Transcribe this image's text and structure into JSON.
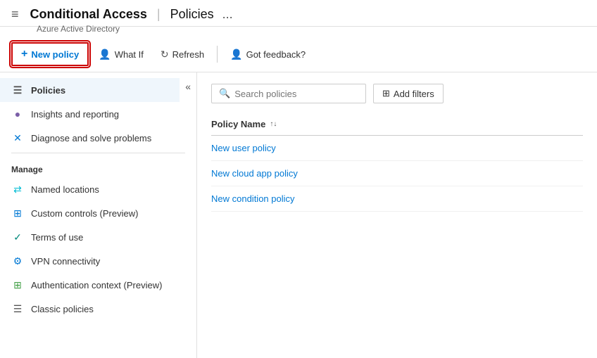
{
  "header": {
    "app_name": "Conditional Access",
    "page_title": "Policies",
    "subtitle": "Azure Active Directory",
    "ellipsis_label": "..."
  },
  "toolbar": {
    "new_policy_label": "New policy",
    "what_if_label": "What If",
    "refresh_label": "Refresh",
    "feedback_label": "Got feedback?"
  },
  "sidebar": {
    "collapse_label": "«",
    "items": [
      {
        "id": "policies",
        "label": "Policies",
        "icon": "☰",
        "active": true
      },
      {
        "id": "insights",
        "label": "Insights and reporting",
        "icon": "💡"
      },
      {
        "id": "diagnose",
        "label": "Diagnose and solve problems",
        "icon": "✕"
      }
    ],
    "manage_section": "Manage",
    "manage_items": [
      {
        "id": "named-locations",
        "label": "Named locations",
        "icon": "◇"
      },
      {
        "id": "custom-controls",
        "label": "Custom controls (Preview)",
        "icon": "⊞"
      },
      {
        "id": "terms-of-use",
        "label": "Terms of use",
        "icon": "✓"
      },
      {
        "id": "vpn",
        "label": "VPN connectivity",
        "icon": "⚙"
      },
      {
        "id": "auth-context",
        "label": "Authentication context (Preview)",
        "icon": "⊞"
      },
      {
        "id": "classic",
        "label": "Classic policies",
        "icon": "☰"
      }
    ]
  },
  "content": {
    "search_placeholder": "Search policies",
    "add_filters_label": "Add filters",
    "table_column": "Policy Name",
    "policies": [
      {
        "name": "New user policy"
      },
      {
        "name": "New cloud app policy"
      },
      {
        "name": "New condition policy"
      }
    ]
  }
}
